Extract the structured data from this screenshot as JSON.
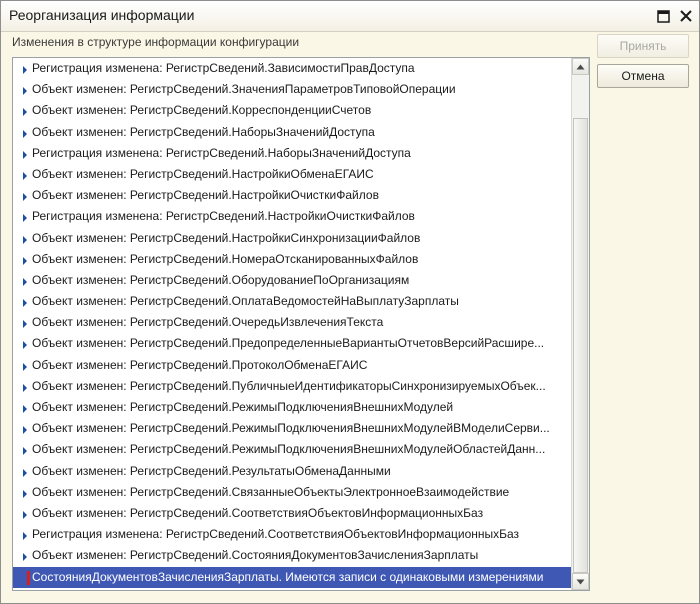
{
  "window": {
    "title": "Реорганизация информации"
  },
  "header": {
    "subtitle": "Изменения в структуре информации конфигурации"
  },
  "buttons": {
    "accept_label": "Принять",
    "cancel_label": "Отмена"
  },
  "list": {
    "items": [
      {
        "text": "Регистрация изменена: РегистрСведений.ЗависимостиПравДоступа"
      },
      {
        "text": "Объект изменен: РегистрСведений.ЗначенияПараметровТиповойОперации"
      },
      {
        "text": "Объект изменен: РегистрСведений.КорреспонденцииСчетов"
      },
      {
        "text": "Объект изменен: РегистрСведений.НаборыЗначенийДоступа"
      },
      {
        "text": "Регистрация изменена: РегистрСведений.НаборыЗначенийДоступа"
      },
      {
        "text": "Объект изменен: РегистрСведений.НастройкиОбменаЕГАИС"
      },
      {
        "text": "Объект изменен: РегистрСведений.НастройкиОчисткиФайлов"
      },
      {
        "text": "Регистрация изменена: РегистрСведений.НастройкиОчисткиФайлов"
      },
      {
        "text": "Объект изменен: РегистрСведений.НастройкиСинхронизацииФайлов"
      },
      {
        "text": "Объект изменен: РегистрСведений.НомераОтсканированныхФайлов"
      },
      {
        "text": "Объект изменен: РегистрСведений.ОборудованиеПоОрганизациям"
      },
      {
        "text": "Объект изменен: РегистрСведений.ОплатаВедомостейНаВыплатуЗарплаты"
      },
      {
        "text": "Объект изменен: РегистрСведений.ОчередьИзвлеченияТекста"
      },
      {
        "text": "Объект изменен: РегистрСведений.ПредопределенныеВариантыОтчетовВерсийРасшире..."
      },
      {
        "text": "Объект изменен: РегистрСведений.ПротоколОбменаЕГАИС"
      },
      {
        "text": "Объект изменен: РегистрСведений.ПубличныеИдентификаторыСинхронизируемыхОбъек..."
      },
      {
        "text": "Объект изменен: РегистрСведений.РежимыПодключенияВнешнихМодулей"
      },
      {
        "text": "Объект изменен: РегистрСведений.РежимыПодключенияВнешнихМодулейВМоделиСерви..."
      },
      {
        "text": "Объект изменен: РегистрСведений.РежимыПодключенияВнешнихМодулейОбластейДанн..."
      },
      {
        "text": "Объект изменен: РегистрСведений.РезультатыОбменаДанными"
      },
      {
        "text": "Объект изменен: РегистрСведений.СвязанныеОбъектыЭлектронноеВзаимодействие"
      },
      {
        "text": "Объект изменен: РегистрСведений.СоответствияОбъектовИнформационныхБаз"
      },
      {
        "text": "Регистрация изменена: РегистрСведений.СоответствияОбъектовИнформационныхБаз"
      },
      {
        "text": "Объект изменен: РегистрСведений.СостоянияДокументовЗачисленияЗарплаты"
      },
      {
        "text": "СостоянияДокументовЗачисленияЗарплаты. Имеются записи с одинаковыми измерениями"
      }
    ],
    "selected_index": 24,
    "scroll_position": 1.0
  },
  "colors": {
    "selection": "#3f58b4",
    "error_marker": "#d42020",
    "arrow": "#1c4fa0"
  }
}
